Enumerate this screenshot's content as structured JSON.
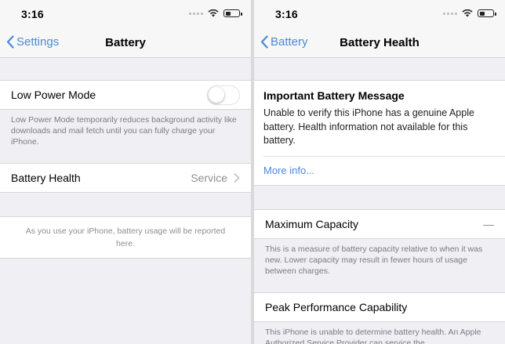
{
  "left": {
    "status": {
      "time": "3:16"
    },
    "nav": {
      "back_label": "Settings",
      "title": "Battery"
    },
    "low_power": {
      "label": "Low Power Mode",
      "enabled": false,
      "footer": "Low Power Mode temporarily reduces background activity like downloads and mail fetch until you can fully charge your iPhone."
    },
    "battery_health": {
      "label": "Battery Health",
      "value": "Service"
    },
    "usage_note": "As you use your iPhone, battery usage will be reported here."
  },
  "right": {
    "status": {
      "time": "3:16"
    },
    "nav": {
      "back_label": "Battery",
      "title": "Battery Health"
    },
    "message": {
      "title": "Important Battery Message",
      "body": "Unable to verify this iPhone has a genuine Apple battery. Health information not available for this battery.",
      "link": "More info..."
    },
    "max_capacity": {
      "label": "Maximum Capacity",
      "value": "—",
      "footer": "This is a measure of battery capacity relative to when it was new. Lower capacity may result in fewer hours of usage between charges."
    },
    "peak_performance": {
      "label": "Peak Performance Capability",
      "footer": "This iPhone is unable to determine battery health. An Apple Authorized Service Provider can service the"
    }
  },
  "colors": {
    "accent": "#4a8ad6",
    "background": "#efeff4",
    "secondary_text": "#8e8e93"
  },
  "icons": [
    "wifi-icon",
    "battery-icon",
    "chevron-left-icon",
    "chevron-right-icon"
  ]
}
